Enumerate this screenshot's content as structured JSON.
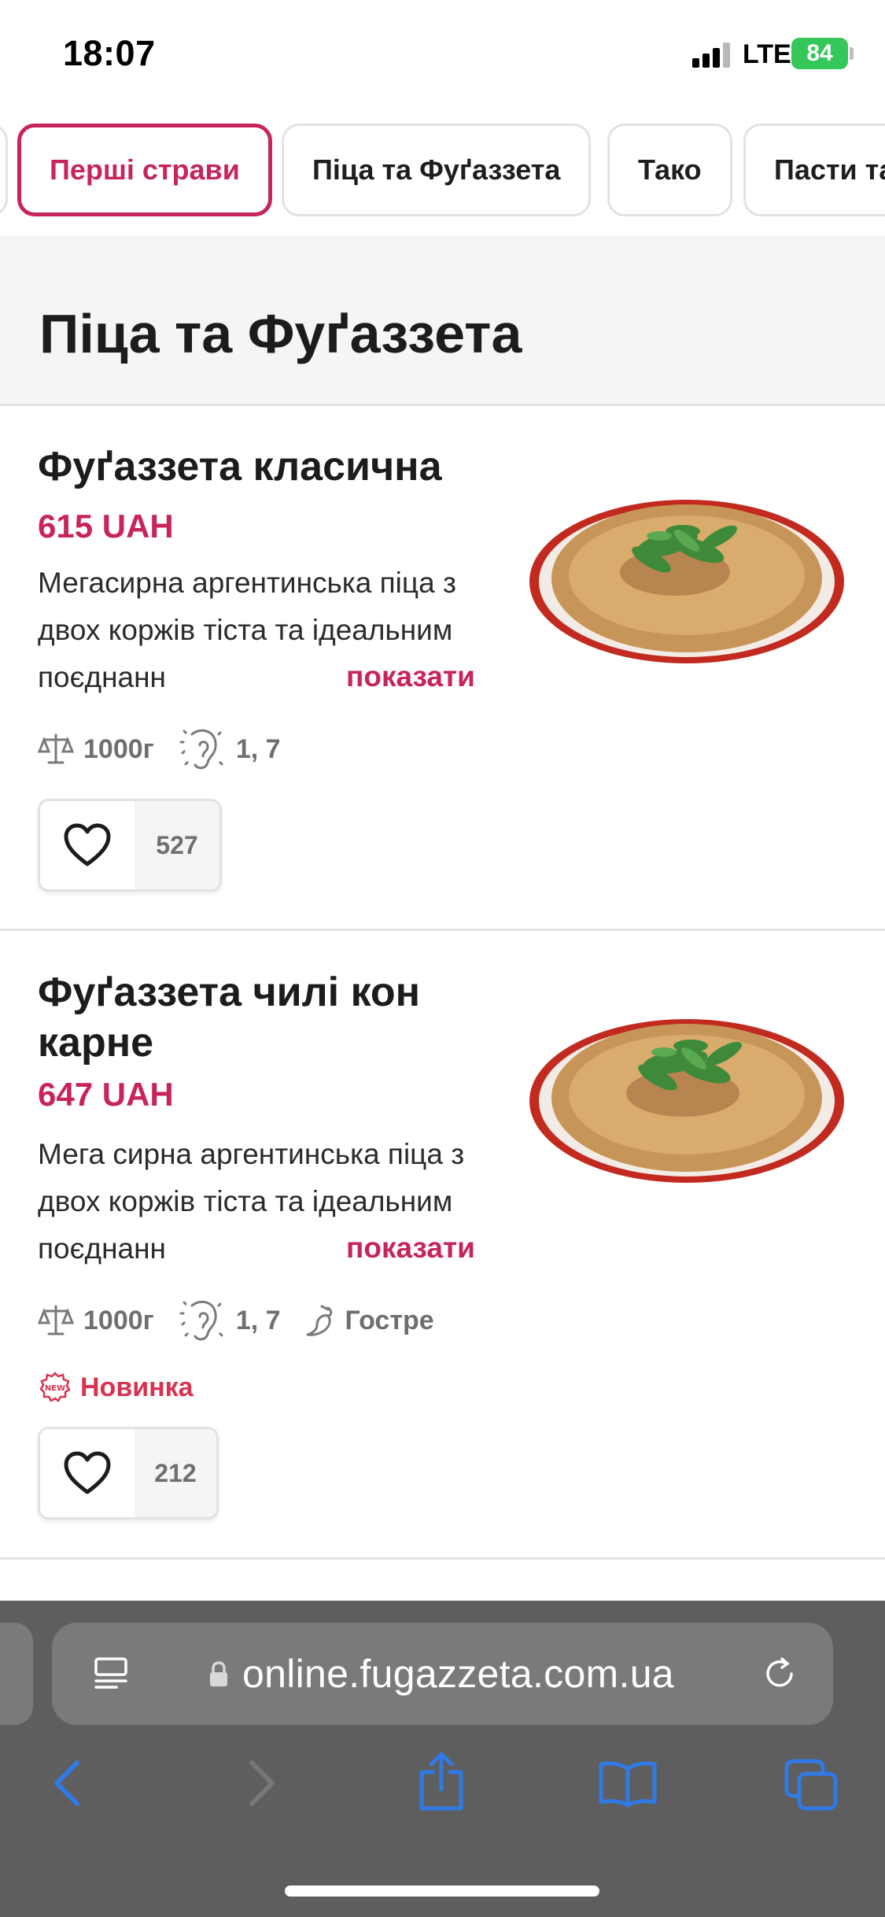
{
  "status_bar": {
    "time": "18:07",
    "network": "LTE",
    "battery": "84"
  },
  "tabs": [
    {
      "label": "Перші страви",
      "active": true
    },
    {
      "label": "Піца та Фуґаззета",
      "active": false
    },
    {
      "label": "Тако",
      "active": false
    },
    {
      "label": "Пасти та",
      "active": false
    }
  ],
  "section": {
    "title": "Піца та Фуґаззета"
  },
  "products": [
    {
      "title": "Фуґаззета класична",
      "price": "615 UAH",
      "description": "Мегасирна аргентинська піца з двох коржів тіста та ідеальним поєднанн",
      "show_more": "показати",
      "weight": "1000г",
      "allergens": "1, 7",
      "likes": "527",
      "image_icon": "pizza-image"
    },
    {
      "title": "Фуґаззета чилі кон карне",
      "price": "647 UAH",
      "description": "Мега сирна аргентинська піца з двох коржів тіста та ідеальним поєднанн",
      "show_more": "показати",
      "weight": "1000г",
      "allergens": "1, 7",
      "spicy": "Гостре",
      "badge": "Новинка",
      "likes": "212",
      "image_icon": "pizza-image"
    }
  ],
  "browser": {
    "url": "online.fugazzeta.com.ua"
  },
  "colors": {
    "accent": "#c8245c",
    "badge_red": "#d83350",
    "battery_green": "#34c759",
    "ios_blue": "#2f7ae5",
    "browser_bar": "#5e5e5e"
  }
}
